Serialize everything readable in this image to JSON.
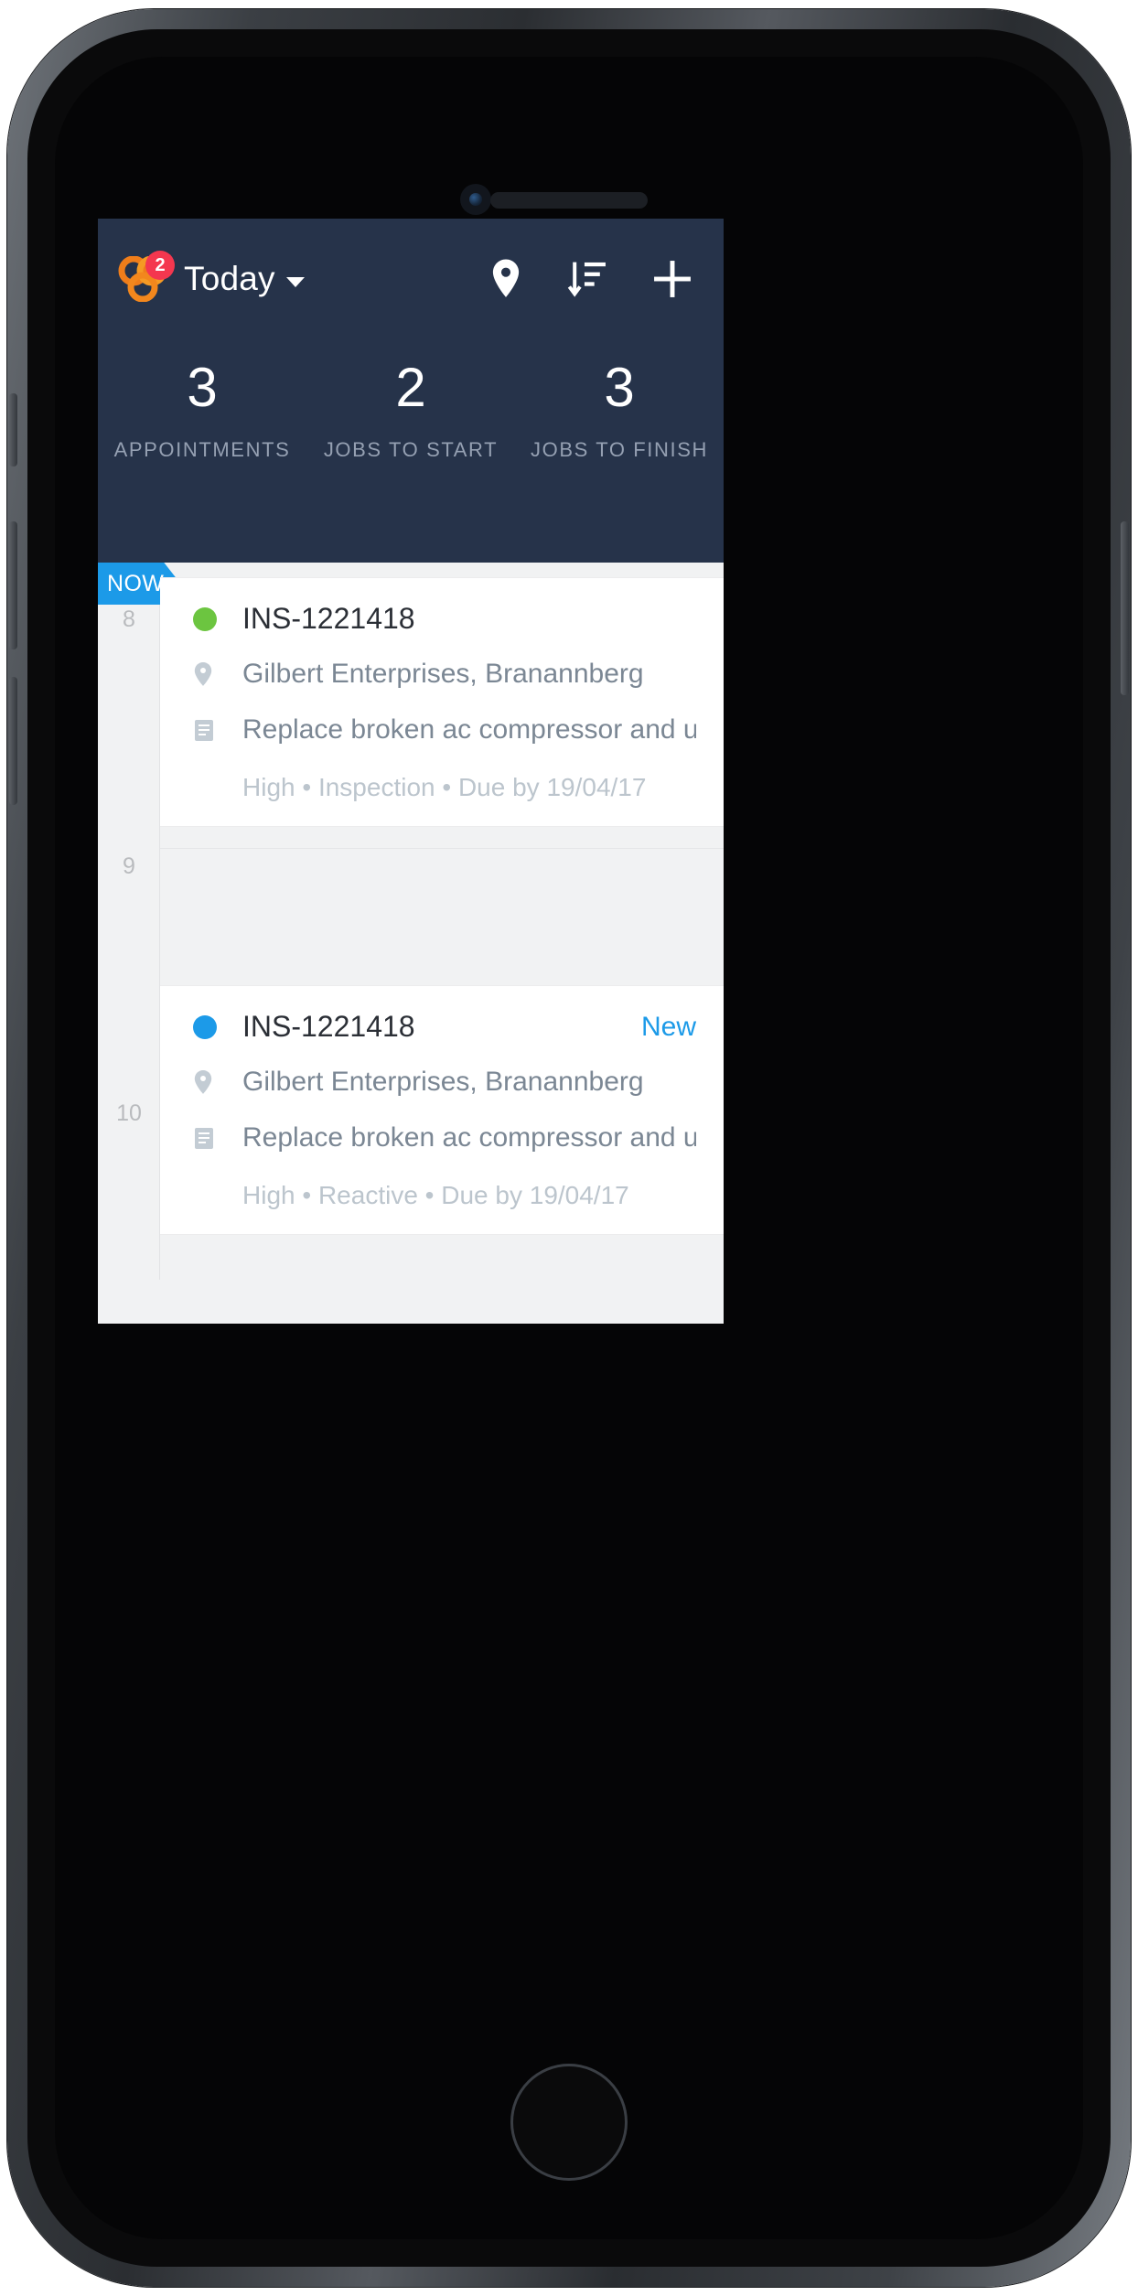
{
  "app": {
    "title": "Today",
    "logo_icon": "trefoil-logo-icon",
    "logo_badge_count": "2",
    "dropdown_icon": "chevron-down-icon",
    "accent_blue": "#1c9ae8",
    "header_bg": "#26334a",
    "brand_orange": "#f08a1e",
    "badge_red": "#f4374f"
  },
  "header_actions": [
    {
      "name": "location-pin-icon",
      "label": "Location"
    },
    {
      "name": "sort-descending-icon",
      "label": "Sort"
    },
    {
      "name": "plus-icon",
      "label": "Add"
    }
  ],
  "stats": [
    {
      "value": "3",
      "label": "APPOINTMENTS"
    },
    {
      "value": "2",
      "label": "JOBS TO START"
    },
    {
      "value": "3",
      "label": "JOBS TO FINISH"
    }
  ],
  "timeline": {
    "now_label": "NOW",
    "hours": [
      "8",
      "9",
      "10"
    ]
  },
  "jobs": [
    {
      "status_color": "#6cc540",
      "status_name": "in-progress",
      "reference": "INS-1221418",
      "flag": "",
      "location_icon": "location-pin-icon",
      "location": "Gilbert Enterprises, Branannberg",
      "description_icon": "document-note-icon",
      "description": "Replace broken ac compressor and up...",
      "priority": "High",
      "type": "Inspection",
      "due": "Due by 19/04/17",
      "meta": "High • Inspection • Due by 19/04/17"
    },
    {
      "status_color": "#1c9ae8",
      "status_name": "new",
      "reference": "INS-1221418",
      "flag": "New",
      "location_icon": "location-pin-icon",
      "location": "Gilbert Enterprises, Branannberg",
      "description_icon": "document-note-icon",
      "description": "Replace broken ac compressor and up...",
      "priority": "High",
      "type": "Reactive",
      "due": "Due by 19/04/17",
      "meta": "High • Reactive • Due by 19/04/17"
    }
  ]
}
